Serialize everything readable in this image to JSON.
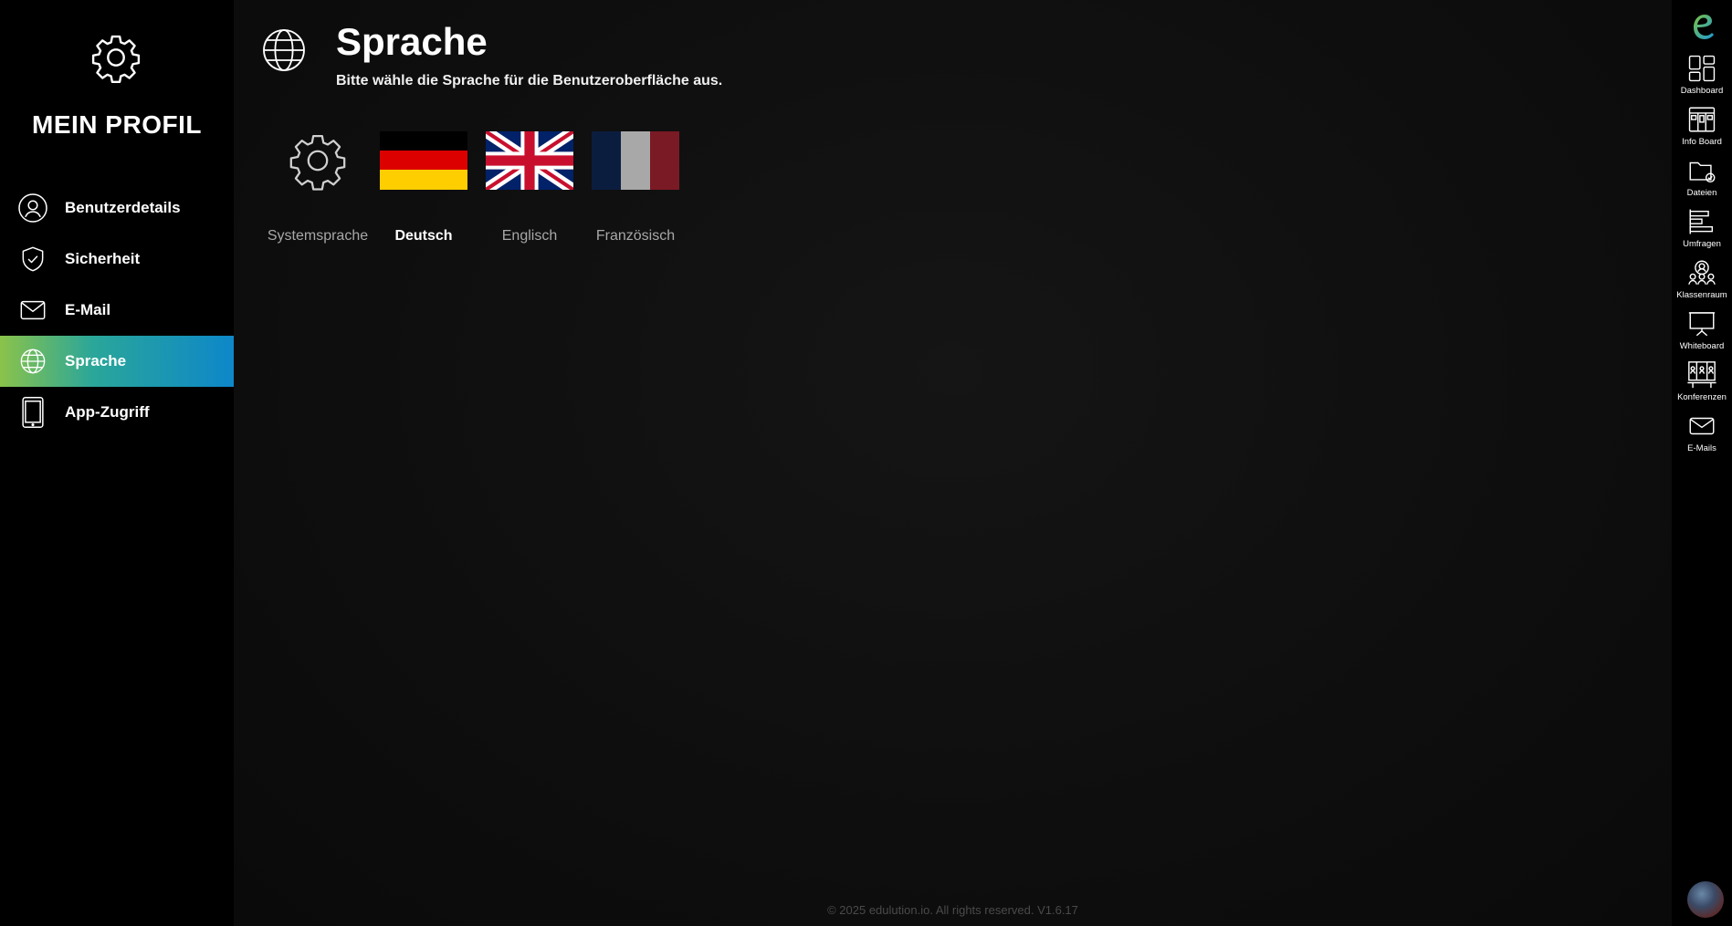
{
  "sidebar": {
    "title": "MEIN PROFIL",
    "items": [
      {
        "label": "Benutzerdetails",
        "icon": "user-gear-icon"
      },
      {
        "label": "Sicherheit",
        "icon": "shield-check-icon"
      },
      {
        "label": "E-Mail",
        "icon": "envelope-icon"
      },
      {
        "label": "Sprache",
        "icon": "globe-icon",
        "active": true
      },
      {
        "label": "App-Zugriff",
        "icon": "tablet-icon"
      }
    ]
  },
  "main": {
    "title": "Sprache",
    "subtitle": "Bitte wähle die Sprache für die Benutzeroberfläche aus.",
    "languages": [
      {
        "label": "Systemsprache",
        "icon": "gear-icon"
      },
      {
        "label": "Deutsch",
        "icon": "german-flag-icon",
        "selected": true
      },
      {
        "label": "Englisch",
        "icon": "uk-flag-icon"
      },
      {
        "label": "Französisch",
        "icon": "french-flag-icon"
      }
    ]
  },
  "footer": {
    "text": "© 2025 edulution.io. All rights reserved. V1.6.17"
  },
  "appbar": {
    "apps": [
      {
        "label": "Dashboard",
        "icon": "dashboard-icon"
      },
      {
        "label": "Info Board",
        "icon": "info-board-icon"
      },
      {
        "label": "Dateien",
        "icon": "files-icon"
      },
      {
        "label": "Umfragen",
        "icon": "surveys-icon"
      },
      {
        "label": "Klassenraum",
        "icon": "classroom-icon"
      },
      {
        "label": "Whiteboard",
        "icon": "whiteboard-icon"
      },
      {
        "label": "Konferenzen",
        "icon": "conferences-icon"
      },
      {
        "label": "E-Mails",
        "icon": "mail-icon"
      }
    ]
  },
  "colors": {
    "active_gradient_start": "#8bc34a",
    "active_gradient_end": "#0d87c9",
    "logo_green": "#7cc242",
    "logo_blue": "#1d9ad6"
  }
}
